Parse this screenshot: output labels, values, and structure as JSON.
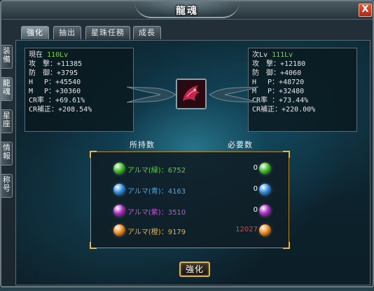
{
  "window": {
    "title": "龍魂",
    "close_label": "X"
  },
  "side_tabs": [
    {
      "chars": [
        "装",
        "備"
      ]
    },
    {
      "chars": [
        "龍",
        "魂"
      ]
    },
    {
      "chars": [
        "星",
        "座"
      ]
    },
    {
      "chars": [
        "情",
        "報"
      ]
    },
    {
      "chars": [
        "称",
        "号"
      ]
    }
  ],
  "tabs": [
    {
      "label": "強化"
    },
    {
      "label": "抽出"
    },
    {
      "label": "星珠任務"
    },
    {
      "label": "成長"
    }
  ],
  "current": {
    "header_label": "現在",
    "level": "110Lv",
    "stats": [
      "攻　撃：+11385",
      "防　御：+3795",
      "H　 P：+45540",
      "M　 P：+30360",
      "CR率 ：+69.61%",
      "CR補正：+208.54%"
    ]
  },
  "next": {
    "header_label": "次Lv",
    "level": "111Lv",
    "stats": [
      "攻　撃：+12180",
      "防　御：+4060",
      "H　 P：+48720",
      "M　 P：+32480",
      "CR率 ：+73.44%",
      "CR補正：+220.00%"
    ]
  },
  "columns": {
    "owned": "所持数",
    "required": "必要数"
  },
  "almas": [
    {
      "name": "アルマ(緑)：6752",
      "required": "0",
      "color": "#3fbf2a",
      "name_color": "#5fd23e",
      "req_color": "#ffffff"
    },
    {
      "name": "アルマ(青)：4163",
      "required": "0",
      "color": "#2f8fe6",
      "name_color": "#4aa6f0",
      "req_color": "#ffffff"
    },
    {
      "name": "アルマ(紫)：3510",
      "required": "0",
      "color": "#b02fc8",
      "name_color": "#c954e0",
      "req_color": "#ffffff"
    },
    {
      "name": "アルマ(橙)：9179",
      "required": "12027",
      "color": "#f08a1c",
      "name_color": "#f0b23a",
      "req_color": "#ff3b2f"
    }
  ],
  "button": {
    "strengthen_label": "強化"
  }
}
